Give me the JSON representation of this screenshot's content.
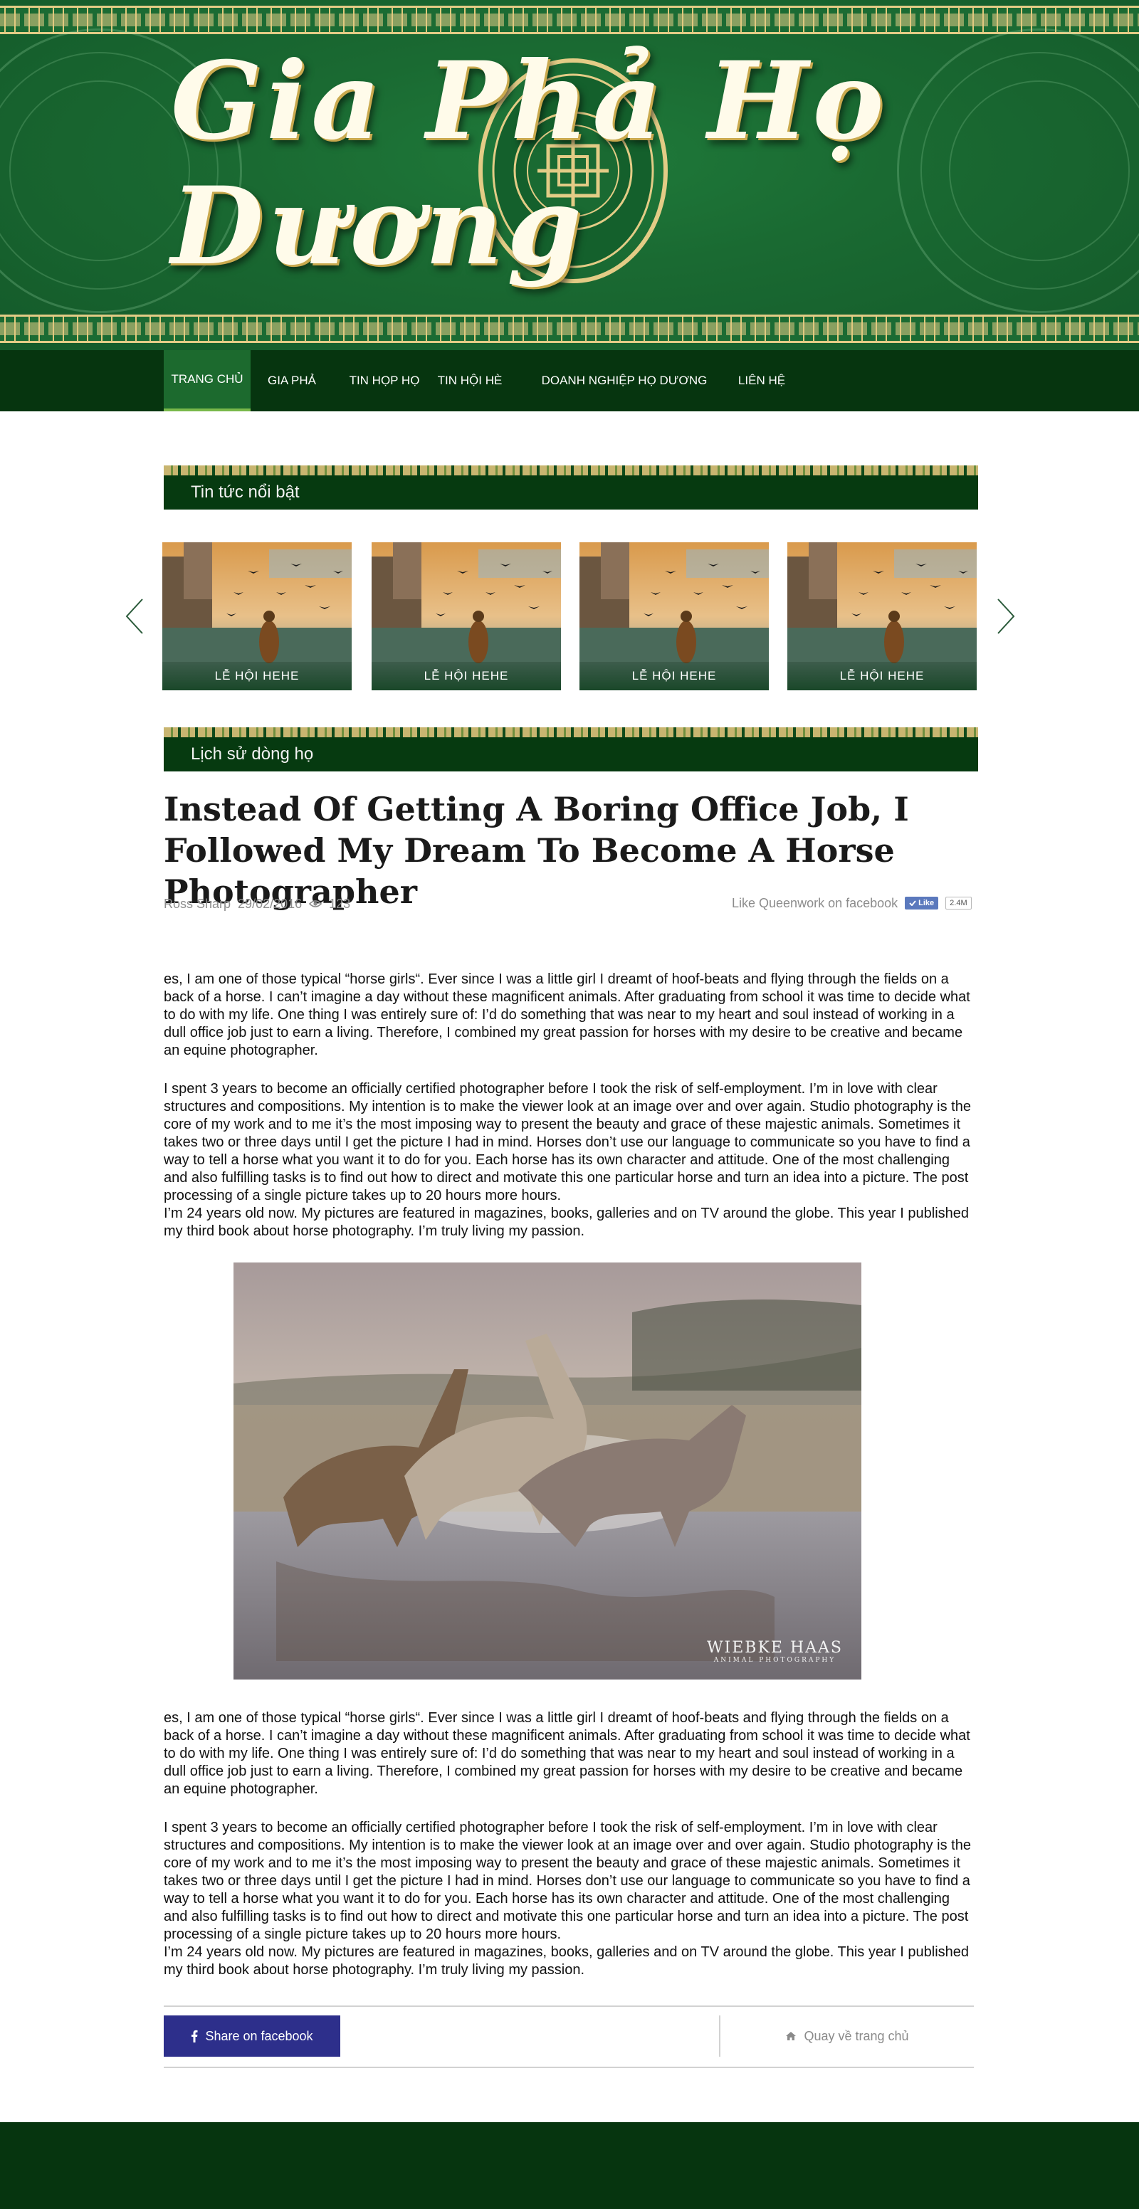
{
  "site": {
    "logo_text": "Gia Phả Họ Dương"
  },
  "nav": {
    "items": [
      {
        "label": "TRANG CHỦ",
        "active": true
      },
      {
        "label": "GIA PHẢ",
        "active": false
      },
      {
        "label": "TIN HỌP HỌ",
        "active": false
      },
      {
        "label": "TIN HỘI HÈ",
        "active": false
      },
      {
        "label": "DOANH NGHIỆP HỌ DƯƠNG",
        "active": false
      },
      {
        "label": "LIÊN HỆ",
        "active": false
      }
    ]
  },
  "featured": {
    "heading": "Tin tức nổi bật",
    "cards": [
      {
        "caption": "LỄ HỘI HEHE"
      },
      {
        "caption": "LỄ HỘI HEHE"
      },
      {
        "caption": "LỄ HỘI HEHE"
      },
      {
        "caption": "LỄ HỘI HEHE"
      }
    ]
  },
  "history": {
    "heading": "Lịch sử dòng họ"
  },
  "article": {
    "title": "Instead Of Getting A Boring Office Job, I Followed My Dream To Become A Horse Photographer",
    "author": "Ross Sharp",
    "date": "29/02/2016",
    "views": "123",
    "fb_like_text": "Like Queenwork on facebook",
    "like_button": "Like",
    "like_count": "2.4M",
    "paragraphs_before": [
      "es, I am one of those typical “horse girls“. Ever since I was a little girl I dreamt of hoof-beats and flying through the fields on a back of a horse. I can’t imagine a day without these magnificent animals. After graduating from school it was time to decide what to do with my life. One thing I was entirely sure of: I’d do something that was near to my heart and soul in­stead of working in a dull office job just to earn a living. Therefore, I combined my great passion for horses with my desire to be creative and became an equine photographer.",
      "I spent 3 years to become an officially certified photographer before I took the risk of self-employment. I’m in love with clear structures and compositions. My intention is to make the viewer look at an image over and over again. Studio pho­tography is the core of my work and to me it’s the most imposing way to present the beauty and grace of these majestic animals. Sometimes it takes two or three days until I get the picture I had in mind. Horses don’t use our language to com­municate so you have to find a way to tell a horse what you want it to do for you. Each horse has its own character and attitude. One of the most challenging and also fulfilling tasks is to find out how to direct and motivate this one particular horse and turn an idea into a picture. The post processing of a single picture takes up to 20 hours more hours.\nI’m 24 years old now. My pictures are featured in magazines, books, galleries and on TV around the globe. This year I published my third book about horse photography. I’m truly living my passion."
    ],
    "image_watermark": "WIEBKE HAAS",
    "image_watermark_sub": "ANIMAL PHOTOGRAPHY",
    "paragraphs_after": [
      "es, I am one of those typical “horse girls“. Ever since I was a little girl I dreamt of hoof-beats and flying through the fields on a back of a horse. I can’t imagine a day without these magnificent animals. After graduating from school it was time to decide what to do with my life. One thing I was entirely sure of: I’d do something that was near to my heart and soul in­stead of working in a dull office job just to earn a living. Therefore, I combined my great passion for horses with my desire to be creative and became an equine photographer.",
      "I spent 3 years to become an officially certified photographer before I took the risk of self-employment. I’m in love with clear structures and compositions. My intention is to make the viewer look at an image over and over again. Studio pho­tography is the core of my work and to me it’s the most imposing way to present the beauty and grace of these majestic animals. Sometimes it takes two or three days until I get the picture I had in mind. Horses don’t use our language to com­municate so you have to find a way to tell a horse what you want it to do for you. Each horse has its own character and attitude. One of the most challenging and also fulfilling tasks is to find out how to direct and motivate this one particular horse and turn an idea into a picture. The post processing of a single picture takes up to 20 hours more hours.\nI’m 24 years old now. My pictures are featured in magazines, books, galleries and on TV around the globe. This year I published my third book about horse photography. I’m truly living my passion."
    ]
  },
  "share": {
    "facebook_label": "Share on facebook",
    "home_label": "Quay về trang chủ"
  },
  "icons": {
    "prev": "chevron-left-icon",
    "next": "chevron-right-icon",
    "views": "eye-icon",
    "like": "check-icon",
    "facebook": "facebook-icon",
    "home": "home-icon"
  },
  "colors": {
    "banner_green": "#1a6a32",
    "nav_dark_green": "#06350f",
    "nav_active": "#1c6a2e",
    "gold": "#e3cc86",
    "share_button": "#2d2f8b",
    "fb_like": "#5b79bd"
  }
}
